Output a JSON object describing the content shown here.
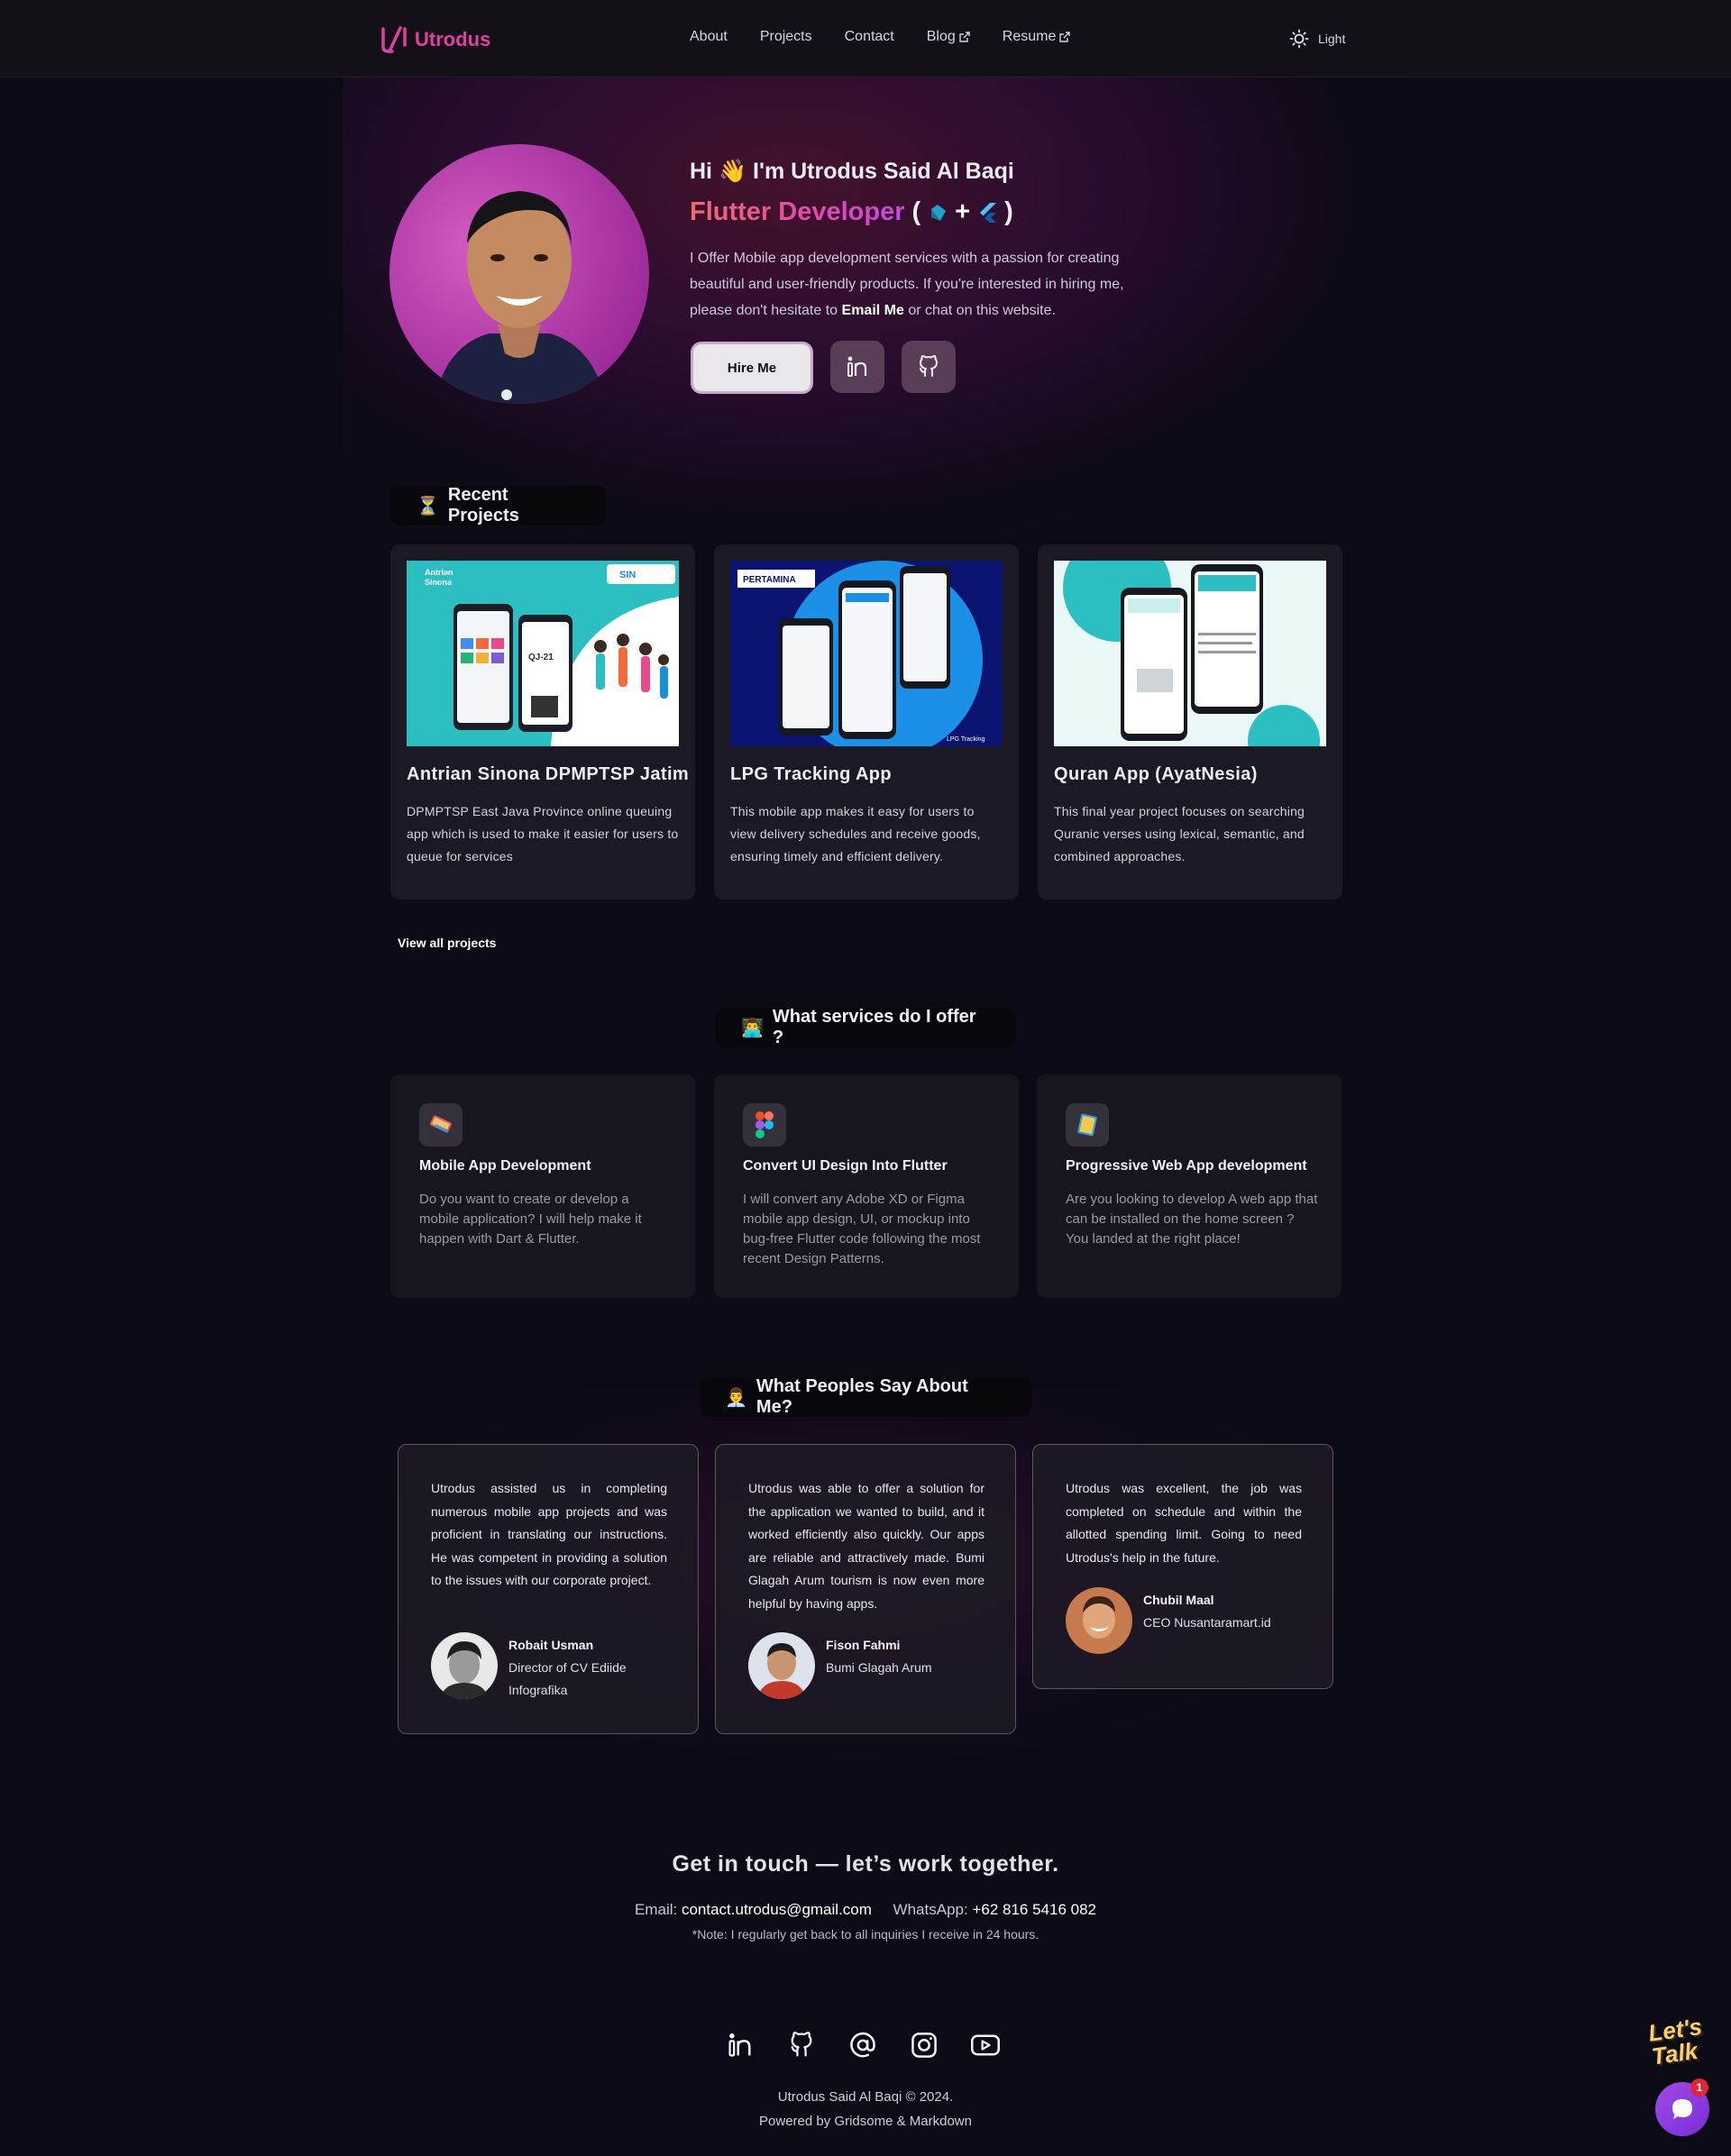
{
  "nav": {
    "brand": "Utrodus",
    "links": [
      {
        "label": "About"
      },
      {
        "label": "Projects"
      },
      {
        "label": "Contact"
      },
      {
        "label": "Blog",
        "external": true
      },
      {
        "label": "Resume",
        "external": true
      }
    ],
    "theme_label": "Light"
  },
  "hero": {
    "greeting_prefix": "Hi",
    "greeting_emoji": "👋",
    "greeting_name": "I'm Utrodus Said Al Baqi",
    "role": "Flutter Developer",
    "role_paren_open": "(",
    "role_plus": "+",
    "role_paren_close": ")",
    "desc_1": "I Offer Mobile app development services with a passion for creating beautiful and user-friendly products. If you're interested in hiring me, please don't hesitate to ",
    "desc_email": "Email Me",
    "desc_2": " or chat on this website.",
    "hire_label": "Hire Me",
    "icons": [
      "linkedin-icon",
      "github-icon"
    ]
  },
  "projects": {
    "heading_emoji": "⏳",
    "heading": "Recent Projects",
    "items": [
      {
        "title": "Antrian Sinona DPMPTSP Jatim",
        "desc": "DPMPTSP East Java Province online queuing app which is used to make it easier for users to queue for services",
        "image_text_1": "Antrian",
        "image_text_2": "Sinona",
        "image_text_3": "SIN",
        "image_text_4": "QJ-21"
      },
      {
        "title": "LPG Tracking App",
        "desc": "This mobile app makes it easy for users to view delivery schedules and receive goods, ensuring timely and efficient delivery.",
        "image_text_1": "PERTAMINA",
        "image_text_2": "LPG Tracking"
      },
      {
        "title": "Quran App (AyatNesia)",
        "desc": "This final year project focuses on searching Quranic verses using lexical, semantic, and combined approaches."
      }
    ],
    "view_all": "View all projects"
  },
  "services": {
    "heading_emoji": "👨‍💻",
    "heading": "What services do I offer ?",
    "items": [
      {
        "title": "Mobile App Development",
        "desc": "Do you want to create or develop a mobile application? I will help make it happen with Dart & Flutter.",
        "icon": "phone-tools-icon"
      },
      {
        "title": "Convert UI Design Into Flutter",
        "desc": "I will convert any Adobe XD or Figma mobile app design, UI, or mockup into bug-free Flutter code following the most recent Design Patterns.",
        "icon": "figma-icon"
      },
      {
        "title": "Progressive Web App development",
        "desc": "Are you looking to develop A web app that can be installed on the home screen ? You landed at the right place!",
        "icon": "pwa-icon"
      }
    ]
  },
  "testimonials": {
    "heading_emoji": "👨‍💼",
    "heading": "What Peoples Say About Me?",
    "items": [
      {
        "quote": "Utrodus assisted us in completing numerous mobile app projects and was proficient in translating our instructions. He was competent in providing a solution to the issues with our corporate project.",
        "name": "Robait Usman",
        "role": "Director of CV Ediide Infografika"
      },
      {
        "quote": "Utrodus was able to offer a solution for the application we wanted to build, and it worked efficiently also quickly. Our apps are reliable and attractively made. Bumi Glagah Arum tourism is now even more helpful by having apps.",
        "name": "Fison Fahmi",
        "role": "Bumi Glagah Arum"
      },
      {
        "quote": "Utrodus was excellent, the job was completed on schedule and within the allotted spending limit. Going to need Utrodus's help in the future.",
        "name": "Chubil Maal",
        "role": "CEO Nusantaramart.id"
      }
    ]
  },
  "contact": {
    "heading": "Get in touch — let’s work together.",
    "email_label": "Email:",
    "email": "contact.utrodus@gmail.com",
    "whatsapp_label": "WhatsApp:",
    "whatsapp": "+62 816 5416 082",
    "note": "*Note: I regularly get back to all inquiries I receive in 24 hours."
  },
  "footer": {
    "socials": [
      "linkedin-icon",
      "github-icon",
      "at-icon",
      "instagram-icon",
      "youtube-icon"
    ],
    "copyright": "Utrodus Said Al Baqi © 2024.",
    "powered": "Powered by Gridsome & Markdown"
  },
  "chat": {
    "lets_talk": "Let's Talk",
    "badge": "1"
  },
  "colors": {
    "background": "#0c0a14",
    "brand": "#e040a0",
    "card": "#1b1a24"
  }
}
